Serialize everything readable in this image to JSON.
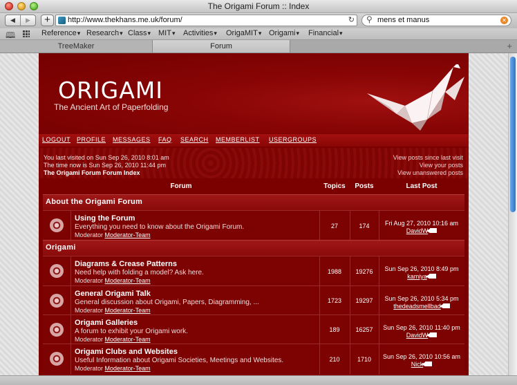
{
  "window": {
    "title": "The Origami Forum :: Index"
  },
  "toolbar": {
    "url": "http://www.thekhans.me.uk/forum/",
    "search": "mens et manus"
  },
  "bookmarks": [
    "Reference",
    "Research",
    "Class",
    "MIT",
    "Activities",
    "OrigaMIT",
    "Origami",
    "Financial"
  ],
  "tabs": [
    "TreeMaker",
    "Forum"
  ],
  "site": {
    "logo": "ORIGAMI",
    "tagline": "The Ancient Art of Paperfolding",
    "nav": [
      "LOGOUT",
      "PROFILE",
      "MESSAGES",
      "FAQ",
      "SEARCH",
      "MEMBERLIST",
      "USERGROUPS"
    ],
    "last_visit": "You last visited on Sun Sep 26, 2010 8:01 am",
    "time_now": "The time now is Sun Sep 26, 2010 11:44 pm",
    "index_link": "The Origami Forum Forum Index",
    "view_since": "View posts since last visit",
    "view_yours": "View your posts",
    "view_unanswered": "View unanswered posts"
  },
  "table": {
    "headers": {
      "forum": "Forum",
      "topics": "Topics",
      "posts": "Posts",
      "last_post": "Last Post"
    },
    "categories": [
      {
        "name": "About the Origami Forum",
        "forums": [
          {
            "title": "Using the Forum",
            "desc": "Everything you need to know about the Origami Forum.",
            "mod_label": "Moderator",
            "mod": "Moderator-Team",
            "topics": "27",
            "posts": "174",
            "last_date": "Fri Aug 27, 2010 10:16 am",
            "last_user": "DavidW"
          }
        ]
      },
      {
        "name": "Origami",
        "forums": [
          {
            "title": "Diagrams & Crease Patterns",
            "desc": "Need help with folding a model? Ask here.",
            "mod_label": "Moderator",
            "mod": "Moderator-Team",
            "topics": "1988",
            "posts": "19276",
            "last_date": "Sun Sep 26, 2010 8:49 pm",
            "last_user": "kamiya"
          },
          {
            "title": "General Origami Talk",
            "desc": "General discussion about Origami, Papers, Diagramming, ...",
            "mod_label": "Moderator",
            "mod": "Moderator-Team",
            "topics": "1723",
            "posts": "19297",
            "last_date": "Sun Sep 26, 2010 5:34 pm",
            "last_user": "thedeadsmellbad"
          },
          {
            "title": "Origami Galleries",
            "desc": "A forum to exhibit your Origami work.",
            "mod_label": "Moderator",
            "mod": "Moderator-Team",
            "topics": "189",
            "posts": "16257",
            "last_date": "Sun Sep 26, 2010 11:40 pm",
            "last_user": "DavidW"
          },
          {
            "title": "Origami Clubs and Websites",
            "desc": "Useful Information about Origami Societies, Meetings and Websites.",
            "mod_label": "Moderator",
            "mod": "Moderator-Team",
            "topics": "210",
            "posts": "1710",
            "last_date": "Sun Sep 26, 2010 10:56 am",
            "last_user": "Nick"
          }
        ]
      }
    ]
  },
  "colors": {
    "brand": "#7a0000",
    "nav": "#a31010",
    "chrome": "#c4c4c4"
  },
  "icons": [
    "search-icon",
    "reload-icon",
    "book-icon",
    "grid-icon",
    "forum-icon",
    "last-post-arrow-icon",
    "crane-logo"
  ]
}
